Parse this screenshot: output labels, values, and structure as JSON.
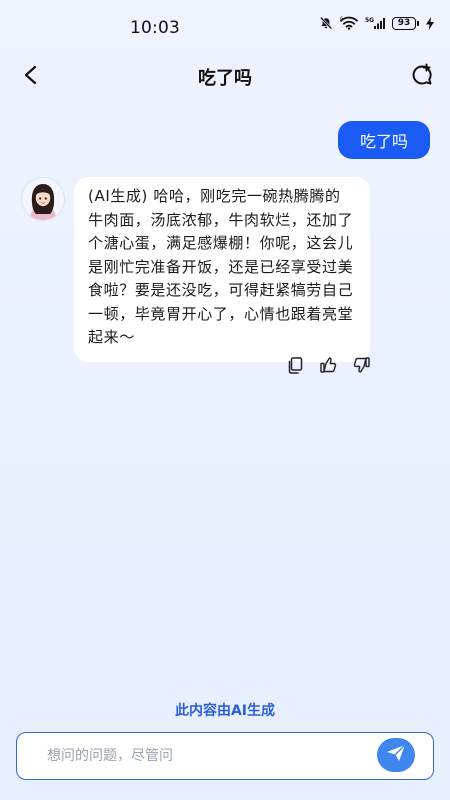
{
  "status_bar": {
    "time": "10:03",
    "battery": "93",
    "network": "5G"
  },
  "header": {
    "title": "吃了吗"
  },
  "messages": {
    "user_text": "吃了吗",
    "ai_text": "(AI生成) 哈哈，刚吃完一碗热腾腾的牛肉面，汤底浓郁，牛肉软烂，还加了个溏心蛋，满足感爆棚！你呢，这会儿是刚忙完准备开饭，还是已经享受过美食啦？要是还没吃，可得赶紧犒劳自己一顿，毕竟胃开心了，心情也跟着亮堂起来～"
  },
  "footer": {
    "disclaimer": "此内容由AI生成",
    "input_placeholder": "想问的问题，尽管问",
    "input_value": ""
  },
  "colors": {
    "accent": "#1a5cf3",
    "send_button": "#3f86ee",
    "disclaimer": "#2b5fd8"
  },
  "icons": {
    "back": "chevron-left-icon",
    "new_chat": "new-chat-icon",
    "copy": "copy-icon",
    "like": "thumbs-up-icon",
    "dislike": "thumbs-down-icon",
    "send": "send-icon",
    "mute": "bell-off-icon",
    "wifi": "wifi-icon",
    "signal": "signal-icon",
    "charging": "charging-icon"
  }
}
